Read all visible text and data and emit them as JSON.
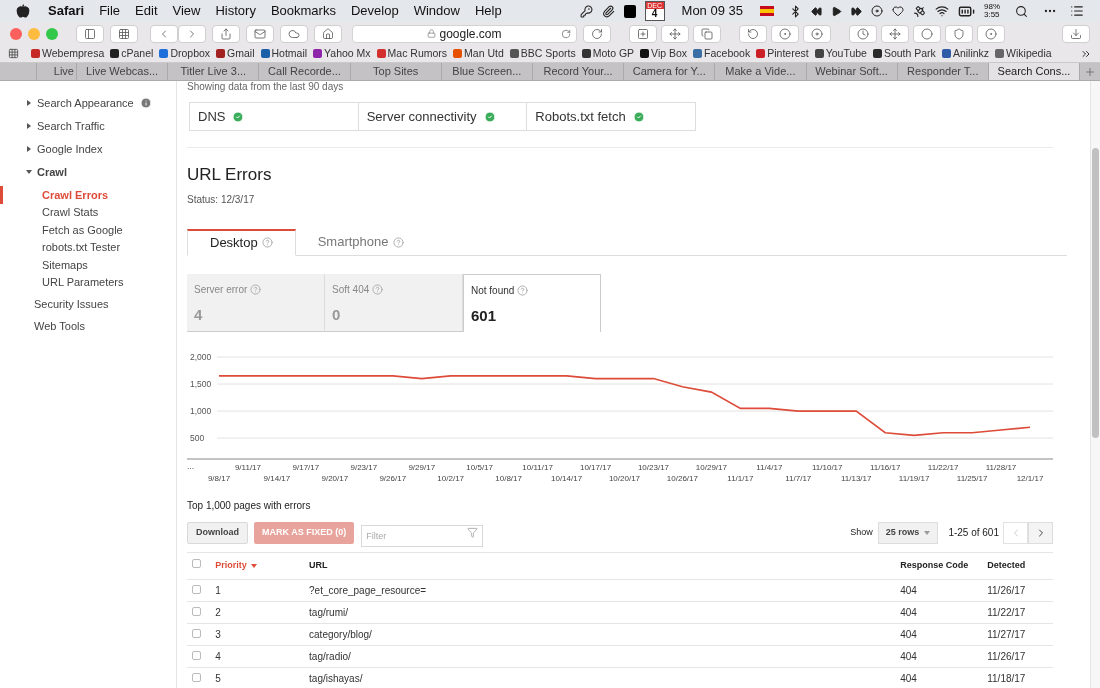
{
  "menu_bar": {
    "app": "Safari",
    "menus": [
      "File",
      "Edit",
      "View",
      "History",
      "Bookmarks",
      "Develop",
      "Window",
      "Help"
    ],
    "calendar": {
      "month": "DEC",
      "day": "4"
    },
    "clock": "Mon 09 35",
    "battery": {
      "percent": "98%",
      "time": "3:55"
    }
  },
  "toolbar": {
    "address": "google.com"
  },
  "bookmarks": [
    {
      "label": "Webempresa",
      "color": "#c62828"
    },
    {
      "label": "cPanel",
      "color": "#222222"
    },
    {
      "label": "Dropbox",
      "color": "#1e6fd9"
    },
    {
      "label": "Gmail",
      "color": "#a32020"
    },
    {
      "label": "Hotmail",
      "color": "#1a5fa8"
    },
    {
      "label": "Yahoo Mx",
      "color": "#8e24aa"
    },
    {
      "label": "Mac Rumors",
      "color": "#d32f2f"
    },
    {
      "label": "Man Utd",
      "color": "#e65100"
    },
    {
      "label": "BBC Sports",
      "color": "#555555"
    },
    {
      "label": "Moto GP",
      "color": "#333333"
    },
    {
      "label": "Vip Box",
      "color": "#111111"
    },
    {
      "label": "Facebook",
      "color": "#3b6ea5"
    },
    {
      "label": "Pinterest",
      "color": "#cb2027"
    },
    {
      "label": "YouTube",
      "color": "#444444"
    },
    {
      "label": "South Park",
      "color": "#2a2a2a"
    },
    {
      "label": "Anilinkz",
      "color": "#2e5aa8"
    },
    {
      "label": "Wikipedia",
      "color": "#666666"
    }
  ],
  "tabs": [
    {
      "label": "Live",
      "selected": false
    },
    {
      "label": "Live Webcas...",
      "selected": false
    },
    {
      "label": "Titler Live 3...",
      "selected": false
    },
    {
      "label": "Call Recorde...",
      "selected": false
    },
    {
      "label": "Top Sites",
      "selected": false
    },
    {
      "label": "Blue Screen...",
      "selected": false
    },
    {
      "label": "Record Your...",
      "selected": false
    },
    {
      "label": "Camera for Y...",
      "selected": false
    },
    {
      "label": "Make a Vide...",
      "selected": false
    },
    {
      "label": "Webinar Soft...",
      "selected": false
    },
    {
      "label": "Responder T...",
      "selected": false
    },
    {
      "label": "Search Cons...",
      "selected": true
    }
  ],
  "sidebar": {
    "items": [
      {
        "label": "Search Appearance",
        "kind": "section",
        "expanded": false,
        "info": true
      },
      {
        "label": "Search Traffic",
        "kind": "section",
        "expanded": false,
        "info": false
      },
      {
        "label": "Google Index",
        "kind": "section",
        "expanded": false,
        "info": false
      },
      {
        "label": "Crawl",
        "kind": "section",
        "expanded": true,
        "info": false,
        "children": [
          {
            "label": "Crawl Errors",
            "selected": true
          },
          {
            "label": "Crawl Stats",
            "selected": false
          },
          {
            "label": "Fetch as Google",
            "selected": false
          },
          {
            "label": "robots.txt Tester",
            "selected": false
          },
          {
            "label": "Sitemaps",
            "selected": false
          },
          {
            "label": "URL Parameters",
            "selected": false
          }
        ]
      },
      {
        "label": "Security Issues",
        "kind": "link"
      },
      {
        "label": "Web Tools",
        "kind": "link"
      }
    ]
  },
  "page": {
    "period_note": "Showing data from the last 90 days",
    "checks": [
      {
        "label": "DNS",
        "ok": true
      },
      {
        "label": "Server connectivity",
        "ok": true
      },
      {
        "label": "Robots.txt fetch",
        "ok": true
      }
    ],
    "title": "URL Errors",
    "status": "Status: 12/3/17",
    "device_tabs": [
      {
        "label": "Desktop",
        "selected": true
      },
      {
        "label": "Smartphone",
        "selected": false
      }
    ],
    "error_types": [
      {
        "label": "Server error",
        "count": "4",
        "selected": false
      },
      {
        "label": "Soft 404",
        "count": "0",
        "selected": false
      },
      {
        "label": "Not found",
        "count": "601",
        "selected": true
      }
    ],
    "chart": {
      "axis_start_label": "...",
      "chart_data": {
        "type": "line",
        "categories": [
          "9/8/17",
          "9/11/17",
          "9/14/17",
          "9/17/17",
          "9/20/17",
          "9/23/17",
          "9/26/17",
          "9/29/17",
          "10/2/17",
          "10/5/17",
          "10/8/17",
          "10/11/17",
          "10/14/17",
          "10/17/17",
          "10/20/17",
          "10/23/17",
          "10/26/17",
          "10/29/17",
          "11/1/17",
          "11/4/17",
          "11/7/17",
          "11/10/17",
          "11/13/17",
          "11/16/17",
          "11/19/17",
          "11/22/17",
          "11/25/17",
          "11/28/17",
          "12/1/17"
        ],
        "series": [
          {
            "color": "#dd4b39",
            "values": [
              1650,
              1650,
              1650,
              1650,
              1650,
              1650,
              1650,
              1600,
              1650,
              1650,
              1650,
              1650,
              1650,
              1600,
              1600,
              1600,
              1450,
              1350,
              1050,
              1050,
              1000,
              1000,
              1000,
              600,
              550,
              600,
              600,
              650,
              700
            ]
          }
        ],
        "grid": true,
        "ylim": [
          150,
          2000
        ],
        "yticks": [
          {
            "value": 500,
            "label": "500"
          },
          {
            "value": 1000,
            "label": "1,000"
          },
          {
            "value": 1500,
            "label": "1,500"
          },
          {
            "value": 2000,
            "label": "2,000"
          }
        ]
      }
    },
    "table_title": "Top 1,000 pages with errors",
    "actions": {
      "download": "Download",
      "mark_fixed": "MARK AS FIXED (0)",
      "mark_fixed_disabled": true,
      "filter_placeholder": "Filter"
    },
    "pager": {
      "show": "Show",
      "rows": "25 rows",
      "range": "1-25 of 601",
      "prev_disabled": true
    },
    "table": {
      "columns": [
        {
          "label": "Priority",
          "sorted": true
        },
        {
          "label": "URL",
          "sorted": false
        },
        {
          "label": "Response Code",
          "sorted": false
        },
        {
          "label": "Detected",
          "sorted": false
        }
      ],
      "all_checked": false,
      "rows": [
        {
          "priority": "1",
          "url": "?et_core_page_resource=",
          "code": "404",
          "detected": "11/26/17",
          "checked": false
        },
        {
          "priority": "2",
          "url": "tag/rumi/",
          "code": "404",
          "detected": "11/22/17",
          "checked": false
        },
        {
          "priority": "3",
          "url": "category/blog/",
          "code": "404",
          "detected": "11/27/17",
          "checked": false
        },
        {
          "priority": "4",
          "url": "tag/radio/",
          "code": "404",
          "detected": "11/26/17",
          "checked": false
        },
        {
          "priority": "5",
          "url": "tag/ishayas/",
          "code": "404",
          "detected": "11/18/17",
          "checked": false
        }
      ]
    }
  }
}
